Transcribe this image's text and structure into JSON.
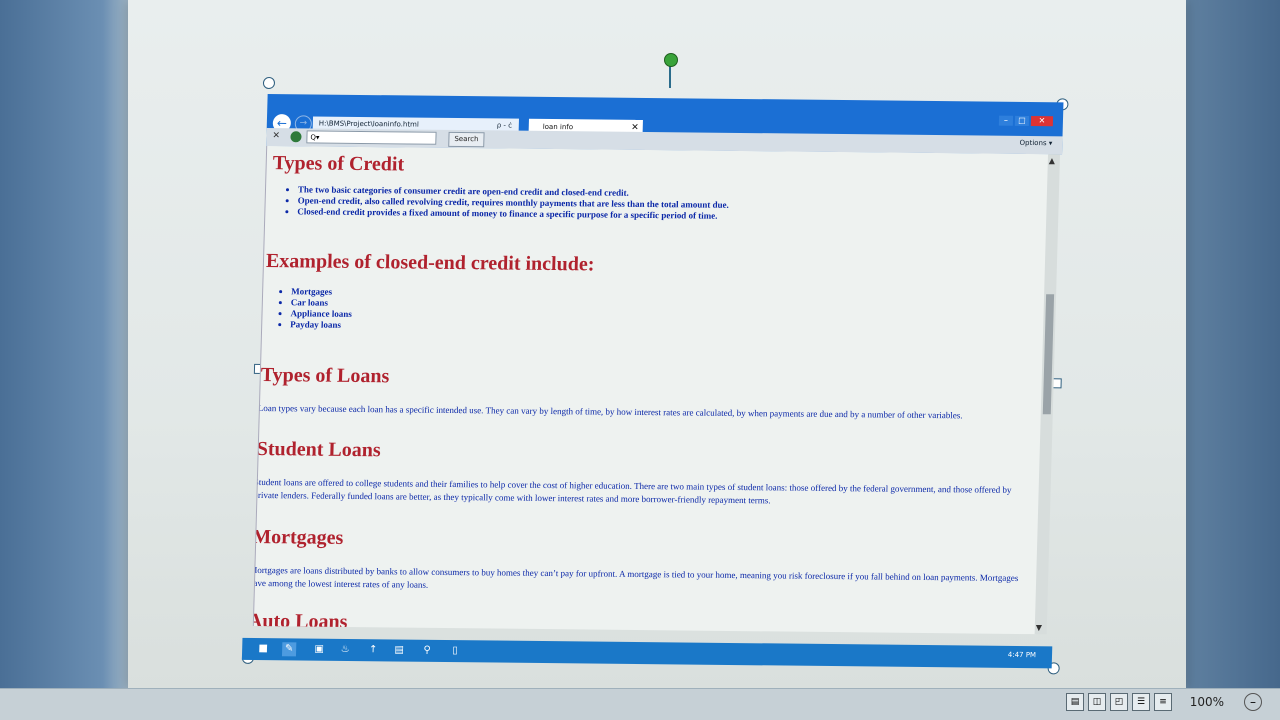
{
  "browser": {
    "address": "H:\\BMS\\Project\\loaninfo.html",
    "address_tools": "ρ - ċ",
    "tab_title": "loan info",
    "search_placeholder": "Q▾",
    "search_button": "Search",
    "options_label": "Options",
    "nav_icons": "⌂ ★ ⚙"
  },
  "page": {
    "sections": [
      {
        "heading": "Types of Credit",
        "bullets": [
          "The two basic categories of consumer credit are open-end credit and closed-end credit.",
          "Open-end credit, also called revolving credit, requires monthly payments that are less than the total amount due.",
          "Closed-end credit provides a fixed amount of money to finance a specific purpose for a specific period of time."
        ]
      },
      {
        "heading": "Examples of closed-end credit include:",
        "bullets": [
          "Mortgages",
          "Car loans",
          "Appliance loans",
          "Payday loans"
        ]
      },
      {
        "heading": "Types of Loans",
        "text": "Loan types vary because each loan has a specific intended use. They can vary by length of time, by how interest rates are calculated, by when payments are due and by a number of other variables."
      },
      {
        "heading": "Student Loans",
        "text": "Student loans are offered to college students and their families to help cover the cost of higher education. There are two main types of student loans: those offered by the federal government, and those offered by private lenders. Federally funded loans are better, as they typically come with lower interest rates and more borrower-friendly repayment terms."
      },
      {
        "heading": "Mortgages",
        "text": "Mortgages are loans distributed by banks to allow consumers to buy homes they can’t pay for upfront. A mortgage is tied to your home, meaning you risk foreclosure if you fall behind on loan payments. Mortgages have among the lowest interest rates of any loans."
      },
      {
        "heading": "Auto Loans"
      }
    ]
  },
  "taskbar": {
    "clock": "4:47 PM"
  },
  "word": {
    "zoom": "100%"
  },
  "colors": {
    "heading": "#b0222e",
    "body_text": "#0b28a8",
    "ie_frame": "#1b6fd4"
  }
}
